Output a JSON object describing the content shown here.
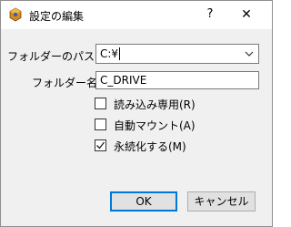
{
  "window": {
    "title": "設定の編集",
    "help": "?",
    "close": "✕"
  },
  "form": {
    "path_label": "フォルダーのパス:",
    "path_value": "C:¥",
    "name_label": "フォルダー名:",
    "name_value": "C_DRIVE"
  },
  "options": [
    {
      "label": "読み込み専用(R)",
      "checked": false
    },
    {
      "label": "自動マウント(A)",
      "checked": false
    },
    {
      "label": "永続化する(M)",
      "checked": true
    }
  ],
  "buttons": {
    "ok": "OK",
    "cancel": "キャンセル"
  },
  "icons": {
    "app": "virtualbox-icon",
    "dropdown": "chevron-down-icon",
    "check": "checkmark-icon"
  }
}
